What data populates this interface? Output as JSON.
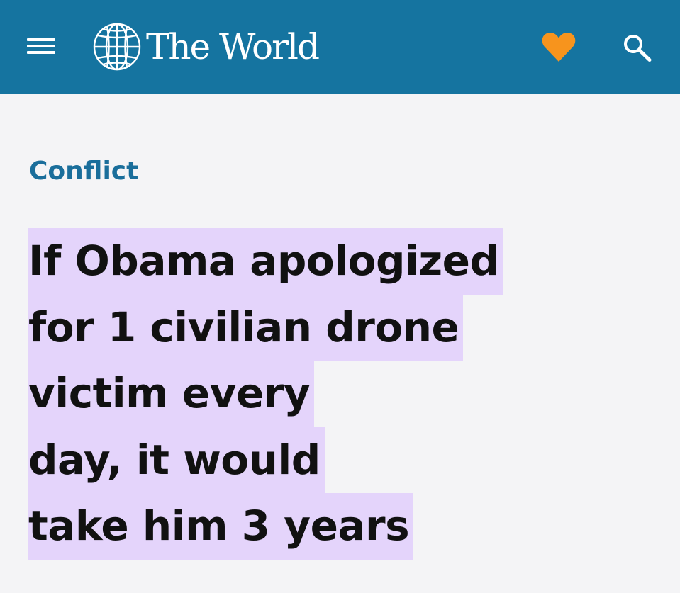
{
  "header": {
    "logo_text": "The World",
    "background_color": "#1574a0",
    "icons": {
      "menu": "hamburger-menu-icon",
      "logo": "globe-icon",
      "favorite": "heart-icon",
      "search": "search-icon"
    },
    "heart_color": "#f7941d"
  },
  "article": {
    "category": "Conflict",
    "category_color": "#1a6e9b",
    "headline_lines": [
      "If Obama apologized",
      "for 1 civilian drone",
      "victim every",
      "day, it would",
      "take him 3 years"
    ],
    "highlight_color": "#e4d4fb"
  }
}
